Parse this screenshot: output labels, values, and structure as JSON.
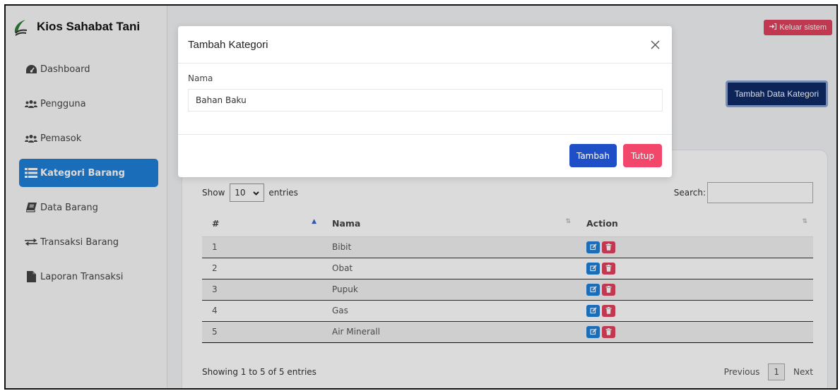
{
  "brand": {
    "title": "Kios Sahabat Tani"
  },
  "sidebar": {
    "items": [
      {
        "label": "Dashboard",
        "icon": "dashboard-icon"
      },
      {
        "label": "Pengguna",
        "icon": "users-icon"
      },
      {
        "label": "Pemasok",
        "icon": "users-icon"
      },
      {
        "label": "Kategori Barang",
        "icon": "list-icon",
        "active": true
      },
      {
        "label": "Data Barang",
        "icon": "book-icon"
      },
      {
        "label": "Transaksi Barang",
        "icon": "exchange-icon"
      },
      {
        "label": "Laporan Transaksi",
        "icon": "file-icon"
      }
    ]
  },
  "header": {
    "logout_label": "Keluar sistem"
  },
  "page": {
    "add_button_label": "Tambah Data Kategori"
  },
  "table_controls": {
    "show_label": "Show",
    "length_value": "10",
    "entries_label": "entries",
    "search_label": "Search:"
  },
  "table": {
    "columns": [
      "#",
      "Nama",
      "Action"
    ],
    "rows": [
      {
        "no": "1",
        "nama": "Bibit"
      },
      {
        "no": "2",
        "nama": "Obat"
      },
      {
        "no": "3",
        "nama": "Pupuk"
      },
      {
        "no": "4",
        "nama": "Gas"
      },
      {
        "no": "5",
        "nama": "Air Minerall"
      }
    ]
  },
  "footer": {
    "info": "Showing 1 to 5 of 5 entries",
    "previous": "Previous",
    "page": "1",
    "next": "Next"
  },
  "modal": {
    "title": "Tambah Kategori",
    "field_label": "Nama",
    "field_value": "Bahan Baku",
    "submit_label": "Tambah",
    "close_label": "Tutup"
  },
  "colors": {
    "active_menu": "#1e7fd8",
    "primary_button": "#1f4fc6",
    "danger_button": "#f2476a",
    "dark_button": "#0e2a66"
  }
}
